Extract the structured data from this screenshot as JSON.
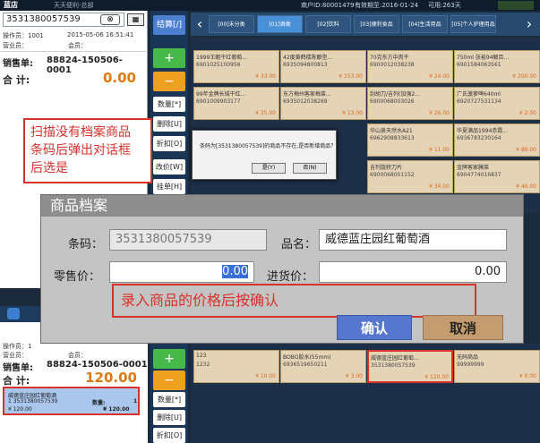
{
  "topbar": {
    "brand": "蓝店",
    "brand_sub": "天天便利-总部",
    "shop": "商户ID:80001479",
    "valid": "有效期至:2016-01-24",
    "days": "可用:263天"
  },
  "left": {
    "scan_value": "3531380057539",
    "clear_label": "⊗",
    "operator_label": "操作员：1001",
    "datetime": "2015-05-06 16:51:41",
    "sales_person_label": "营业员：",
    "member_label": "会员：",
    "sale_label": "销售单:",
    "sale_no": "88824-150506-0001",
    "total_label": "合  计:",
    "total_value": "0.00"
  },
  "func": {
    "checkout": "结算[/]",
    "plus": "+",
    "minus": "−",
    "qty": "数量[*]",
    "delete": "删除[U]",
    "discount": "折扣[O]",
    "change_price": "改价[W]",
    "hold": "挂单[H]"
  },
  "cats": [
    "[00]未分类",
    "[01]酒类",
    "[02]饮料",
    "[03]便利食品",
    "[04]生活用品",
    "[05]个人护理用品"
  ],
  "products": [
    {
      "name": "1999王朝干红葡萄...",
      "code": "6901025100956",
      "price": "¥ 33.00"
    },
    {
      "name": "42度黄鹤楼陈酿型...",
      "code": "6935094800813",
      "price": "¥ 153.00"
    },
    {
      "name": "70克东方中肉干",
      "code": "6900012038238",
      "price": "¥ 24.00"
    },
    {
      "name": "750ml 张裕94解百...",
      "code": "6901584063561",
      "price": "¥ 200.00"
    },
    {
      "name": "99年金牌长城干红...",
      "code": "6901009903177",
      "price": "¥ 35.00"
    },
    {
      "name": "东方梅州客家梅菜...",
      "code": "6935012038269",
      "price": "¥ 13.00"
    },
    {
      "name": "刮胡刀/吉列(加强2...",
      "code": "6900068003026",
      "price": "¥ 26.00"
    },
    {
      "name": "广氏菠萝啤640ml",
      "code": "6920727531134",
      "price": "¥ 2.00"
    },
    {
      "name": "华山泉天然水A21",
      "code": "6962908833613",
      "price": "¥ 11.00"
    },
    {
      "name": "华夏满品1994赤霞...",
      "code": "6936783230164",
      "price": "¥ 88.00"
    },
    {
      "name": "吉列旋转刀片",
      "code": "6900068001152",
      "price": "¥ 34.00"
    },
    {
      "name": "金牌客家腌菜",
      "code": "6904774016837",
      "price": "¥ 46.00"
    }
  ],
  "annotation1": [
    "扫描没有档案商品",
    "条码后弹出对话框",
    "后选是"
  ],
  "small_dialog": {
    "message": "条码为[3531380057539]的商品不存在,是否新增商品？",
    "yes": "是(Y)",
    "no": "否(N)"
  },
  "archive_dialog": {
    "title": "商品档案",
    "barcode_label": "条码：",
    "barcode_value": "3531380057539",
    "name_label": "品名：",
    "name_value": "威德蓝庄园红葡萄酒",
    "retail_label": "零售价：",
    "retail_value": "0.00",
    "purchase_label": "进货价：",
    "purchase_value": "0.00",
    "confirm": "确认",
    "cancel": "取消"
  },
  "annotation2": "录入商品的价格后按确认",
  "lower": {
    "operator_label": "操作员：1",
    "sales_person_label": "营业员：",
    "member_label": "会员：",
    "sale_label": "销售单:",
    "sale_no": "88824-150506-0001",
    "total_label": "合  计:",
    "total_value": "120.00",
    "item_name": "威德蓝庄园红葡萄酒",
    "item_line2": "1  3531380057539",
    "item_qty_label": "数量:",
    "item_qty": "1",
    "item_price": "¥ 120.00",
    "item_amount": "¥ 120.00",
    "qty": "数量[*]",
    "delete": "删除[U]",
    "discount": "折扣[O]",
    "plus": "+",
    "minus": "−",
    "products": [
      {
        "name": "123",
        "code": "1232",
        "price": "¥ 10.00"
      },
      {
        "name": "BOBO胶水(55mm)",
        "code": "6936519650211",
        "price": "¥ 3.00"
      },
      {
        "name": "威德蓝庄园红葡萄...",
        "code": "3531380057539",
        "price": "¥ 120.00"
      },
      {
        "name": "无码商品",
        "code": "99999999",
        "price": "¥ 0.00"
      }
    ]
  },
  "colors": {
    "accent_orange": "#e07a10",
    "annotation_red": "#d8322c",
    "dialog_gray": "#c4c4c4",
    "confirm_blue": "#5677d0",
    "cancel_tan": "#c49c70",
    "tile_tan": "#e5d3b6"
  }
}
